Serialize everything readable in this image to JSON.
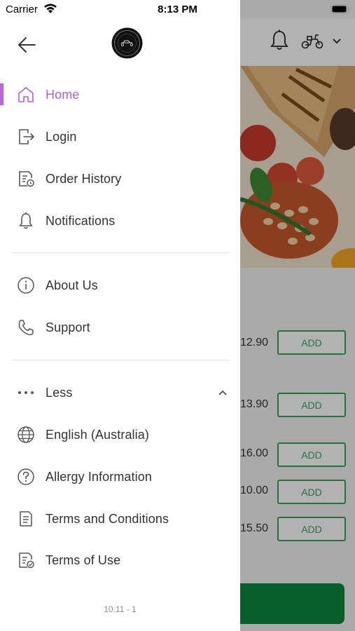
{
  "status_bar": {
    "carrier": "Carrier",
    "time": "8:13 PM"
  },
  "colors": {
    "accent": "#b45fd6",
    "active_indicator": "#b768d9",
    "text": "#333333",
    "divider": "#e3e3e3",
    "add_button": "#3aa35a",
    "cta": "#0b8a3b"
  },
  "drawer": {
    "back_icon": "arrow-left-icon",
    "logo_icon": "restaurant-logo",
    "primary_items": [
      {
        "label": "Home",
        "icon": "home-icon",
        "active": true
      },
      {
        "label": "Login",
        "icon": "login-icon",
        "active": false
      },
      {
        "label": "Order History",
        "icon": "order-history-icon",
        "active": false
      },
      {
        "label": "Notifications",
        "icon": "bell-icon",
        "active": false
      }
    ],
    "secondary_items": [
      {
        "label": "About Us",
        "icon": "info-icon"
      },
      {
        "label": "Support",
        "icon": "phone-icon"
      }
    ],
    "more_section": {
      "label": "Less",
      "icon": "more-dots-icon",
      "expanded": true
    },
    "tertiary_items": [
      {
        "label": "English (Australia)",
        "icon": "globe-icon"
      },
      {
        "label": "Allergy Information",
        "icon": "question-icon"
      },
      {
        "label": "Terms and Conditions",
        "icon": "document-icon"
      },
      {
        "label": "Terms of Use",
        "icon": "document-check-icon"
      }
    ],
    "version": "10.11 - 1"
  },
  "background": {
    "header_icons": [
      "bell-icon",
      "scooter-icon",
      "chevron-down-icon"
    ],
    "menu_items": [
      {
        "price": "12.90",
        "button": "ADD"
      },
      {
        "price": "13.90",
        "button": "ADD"
      },
      {
        "price": "16.00",
        "button": "ADD"
      },
      {
        "price": "10.00",
        "button": "ADD"
      },
      {
        "price": "15.50",
        "button": "ADD"
      }
    ]
  }
}
